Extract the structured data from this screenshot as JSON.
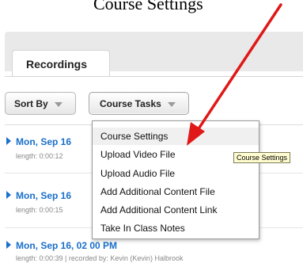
{
  "banner": {
    "text": "Course Settings"
  },
  "tabs": [
    {
      "label": "Recordings"
    }
  ],
  "toolbar": {
    "sort_label": "Sort By",
    "tasks_label": "Course Tasks"
  },
  "recordings": [
    {
      "title": "Mon, Sep 16",
      "meta": "length: 0:00:12"
    },
    {
      "title": "Mon, Sep 16",
      "meta": "length: 0:00:15"
    },
    {
      "title": "Mon, Sep 16, 02 00 PM",
      "meta": "length: 0:00:39 | recorded by: Kevin (Kevin) Halbrook"
    }
  ],
  "menu": {
    "items": [
      {
        "label": "Course Settings"
      },
      {
        "label": "Upload Video File"
      },
      {
        "label": "Upload Audio File"
      },
      {
        "label": "Add Additional Content File"
      },
      {
        "label": "Add Additional Content Link"
      },
      {
        "label": "Take In Class Notes"
      }
    ]
  },
  "tooltip": {
    "text": "Course Settings"
  },
  "colors": {
    "link": "#1a6fc9",
    "arrow": "#e01818",
    "tooltip_bg": "#fffdd0"
  }
}
